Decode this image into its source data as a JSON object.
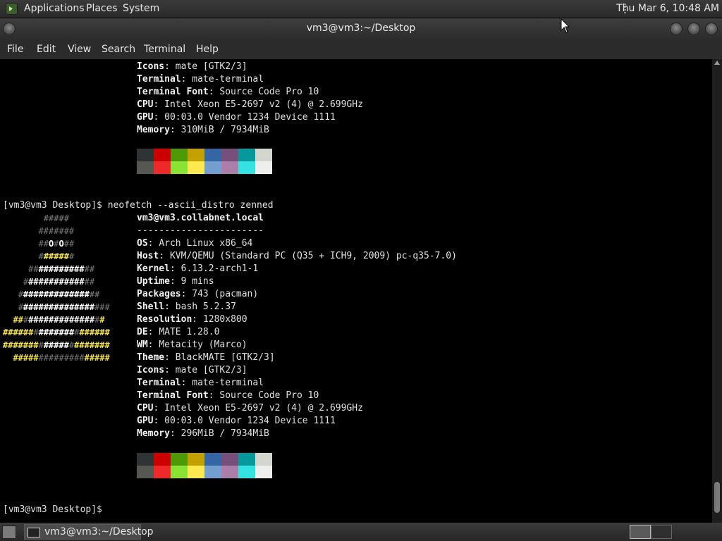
{
  "top_panel": {
    "menus": [
      "Applications",
      "Places",
      "System"
    ],
    "clock": "Thu Mar  6, 10:48 AM"
  },
  "window": {
    "title": "vm3@vm3:~/Desktop"
  },
  "menubar": [
    "File",
    "Edit",
    "View",
    "Search",
    "Terminal",
    "Help"
  ],
  "terminal": {
    "first_block": [
      {
        "k": "Icons",
        "v": "mate [GTK2/3]"
      },
      {
        "k": "Terminal",
        "v": "mate-terminal"
      },
      {
        "k": "Terminal Font",
        "v": "Source Code Pro 10"
      },
      {
        "k": "CPU",
        "v": "Intel Xeon E5-2697 v2 (4) @ 2.699GHz"
      },
      {
        "k": "GPU",
        "v": "00:03.0 Vendor 1234 Device 1111"
      },
      {
        "k": "Memory",
        "v": "310MiB / 7934MiB"
      }
    ],
    "prompt": "[vm3@vm3 Desktop]$ ",
    "command": "neofetch --ascii_distro zenned",
    "user_host": "vm3@vm3.collabnet.local",
    "separator": "-----------------------",
    "second_block": [
      {
        "k": "OS",
        "v": "Arch Linux x86_64"
      },
      {
        "k": "Host",
        "v": "KVM/QEMU (Standard PC (Q35 + ICH9, 2009) pc-q35-7.0)"
      },
      {
        "k": "Kernel",
        "v": "6.13.2-arch1-1"
      },
      {
        "k": "Uptime",
        "v": "9 mins"
      },
      {
        "k": "Packages",
        "v": "743 (pacman)"
      },
      {
        "k": "Shell",
        "v": "bash 5.2.37"
      },
      {
        "k": "Resolution",
        "v": "1280x800"
      },
      {
        "k": "DE",
        "v": "MATE 1.28.0"
      },
      {
        "k": "WM",
        "v": "Metacity (Marco)"
      },
      {
        "k": "Theme",
        "v": "BlackMATE [GTK2/3]"
      },
      {
        "k": "Icons",
        "v": "mate [GTK2/3]"
      },
      {
        "k": "Terminal",
        "v": "mate-terminal"
      },
      {
        "k": "Terminal Font",
        "v": "Source Code Pro 10"
      },
      {
        "k": "CPU",
        "v": "Intel Xeon E5-2697 v2 (4) @ 2.699GHz"
      },
      {
        "k": "GPU",
        "v": "00:03.0 Vendor 1234 Device 1111"
      },
      {
        "k": "Memory",
        "v": "296MiB / 7934MiB"
      }
    ],
    "final_prompt": "[vm3@vm3 Desktop]$",
    "palette_top": [
      "#2e3436",
      "#cc0000",
      "#4e9a06",
      "#c4a000",
      "#3465a4",
      "#75507b",
      "#06989a",
      "#d3d7cf"
    ],
    "palette_bottom": [
      "#555753",
      "#ef2929",
      "#8ae234",
      "#fce94f",
      "#729fcf",
      "#ad7fa8",
      "#34e2e2",
      "#eeeeec"
    ]
  },
  "ascii_art": [
    [
      [
        "        ",
        "s"
      ],
      [
        "#####",
        "d"
      ]
    ],
    [
      [
        "       ",
        "s"
      ],
      [
        "#######",
        "d"
      ]
    ],
    [
      [
        "       ",
        "s"
      ],
      [
        "##",
        "d"
      ],
      [
        "O",
        "w"
      ],
      [
        "#",
        "d"
      ],
      [
        "O",
        "w"
      ],
      [
        "##",
        "d"
      ]
    ],
    [
      [
        "       ",
        "s"
      ],
      [
        "#",
        "d"
      ],
      [
        "#####",
        "y"
      ],
      [
        "#",
        "d"
      ]
    ],
    [
      [
        "     ",
        "s"
      ],
      [
        "##",
        "d"
      ],
      [
        "#########",
        "w"
      ],
      [
        "##",
        "d"
      ]
    ],
    [
      [
        "    ",
        "s"
      ],
      [
        "#",
        "d"
      ],
      [
        "###########",
        "w"
      ],
      [
        "##",
        "d"
      ]
    ],
    [
      [
        "   ",
        "s"
      ],
      [
        "#",
        "d"
      ],
      [
        "#############",
        "w"
      ],
      [
        "##",
        "d"
      ]
    ],
    [
      [
        "   ",
        "s"
      ],
      [
        "#",
        "d"
      ],
      [
        "##############",
        "w"
      ],
      [
        "###",
        "d"
      ]
    ],
    [
      [
        "  ",
        "s"
      ],
      [
        "##",
        "y"
      ],
      [
        "#",
        "d"
      ],
      [
        "#############",
        "w"
      ],
      [
        "#",
        "d"
      ],
      [
        "#",
        "y"
      ]
    ],
    [
      [
        "",
        "s"
      ],
      [
        "######",
        "y"
      ],
      [
        "#",
        "d"
      ],
      [
        "#######",
        "w"
      ],
      [
        "#",
        "d"
      ],
      [
        "######",
        "y"
      ]
    ],
    [
      [
        "",
        "s"
      ],
      [
        "#######",
        "y"
      ],
      [
        "#",
        "d"
      ],
      [
        "#####",
        "w"
      ],
      [
        "#",
        "d"
      ],
      [
        "#######",
        "y"
      ]
    ],
    [
      [
        "  ",
        "s"
      ],
      [
        "#####",
        "y"
      ],
      [
        "#########",
        "d"
      ],
      [
        "#####",
        "y"
      ]
    ]
  ],
  "taskbar": {
    "task_label": "vm3@vm3:~/Desktop"
  },
  "icons": {
    "app_menu": "terminal-app-icon",
    "cursor": "mouse-pointer-icon",
    "task": "terminal-window-icon"
  }
}
